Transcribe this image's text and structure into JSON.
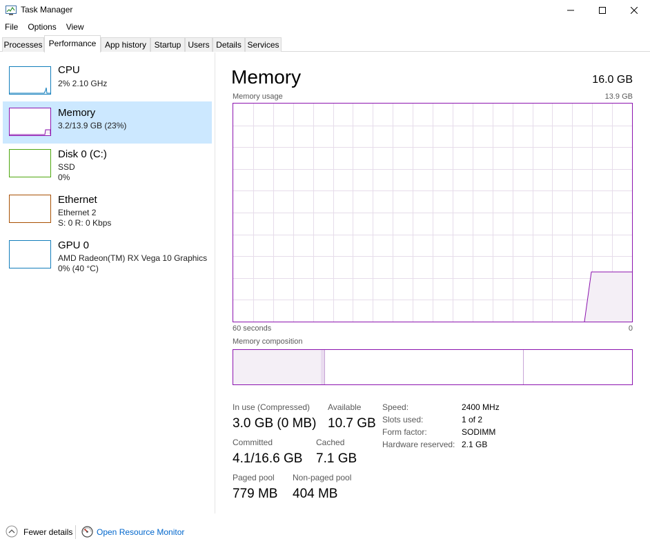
{
  "window": {
    "title": "Task Manager"
  },
  "menu": [
    "File",
    "Options",
    "View"
  ],
  "tabs": [
    "Processes",
    "Performance",
    "App history",
    "Startup",
    "Users",
    "Details",
    "Services"
  ],
  "active_tab": "Performance",
  "resources": [
    {
      "name": "CPU",
      "line1": "2%  2.10 GHz",
      "line2": "",
      "color": "#117dbb"
    },
    {
      "name": "Memory",
      "line1": "3.2/13.9 GB (23%)",
      "line2": "",
      "color": "#8b12ae"
    },
    {
      "name": "Disk 0 (C:)",
      "line1": "SSD",
      "line2": "0%",
      "color": "#4da60c"
    },
    {
      "name": "Ethernet",
      "line1": "Ethernet 2",
      "line2": "S: 0  R: 0 Kbps",
      "color": "#a74f01"
    },
    {
      "name": "GPU 0",
      "line1": "AMD Radeon(TM) RX Vega 10 Graphics",
      "line2": "0%  (40 °C)",
      "color": "#117dbb"
    }
  ],
  "memory": {
    "heading": "Memory",
    "total": "16.0 GB",
    "usage_label": "Memory usage",
    "usage_max": "13.9 GB",
    "time_label": "60 seconds",
    "time_end": "0",
    "composition_label": "Memory composition",
    "stats": {
      "in_use_label": "In use (Compressed)",
      "in_use_value": "3.0 GB (0 MB)",
      "available_label": "Available",
      "available_value": "10.7 GB",
      "committed_label": "Committed",
      "committed_value": "4.1/16.6 GB",
      "cached_label": "Cached",
      "cached_value": "7.1 GB",
      "paged_label": "Paged pool",
      "paged_value": "779 MB",
      "nonpaged_label": "Non-paged pool",
      "nonpaged_value": "404 MB"
    },
    "details": [
      {
        "label": "Speed:",
        "value": "2400 MHz"
      },
      {
        "label": "Slots used:",
        "value": "1 of 2"
      },
      {
        "label": "Form factor:",
        "value": "SODIMM"
      },
      {
        "label": "Hardware reserved:",
        "value": "2.1 GB"
      }
    ]
  },
  "footer": {
    "fewer_details": "Fewer details",
    "resource_monitor": "Open Resource Monitor"
  },
  "colors": {
    "accent": "#8b12ae",
    "selected_bg": "#cce8ff",
    "link": "#0066cc"
  }
}
